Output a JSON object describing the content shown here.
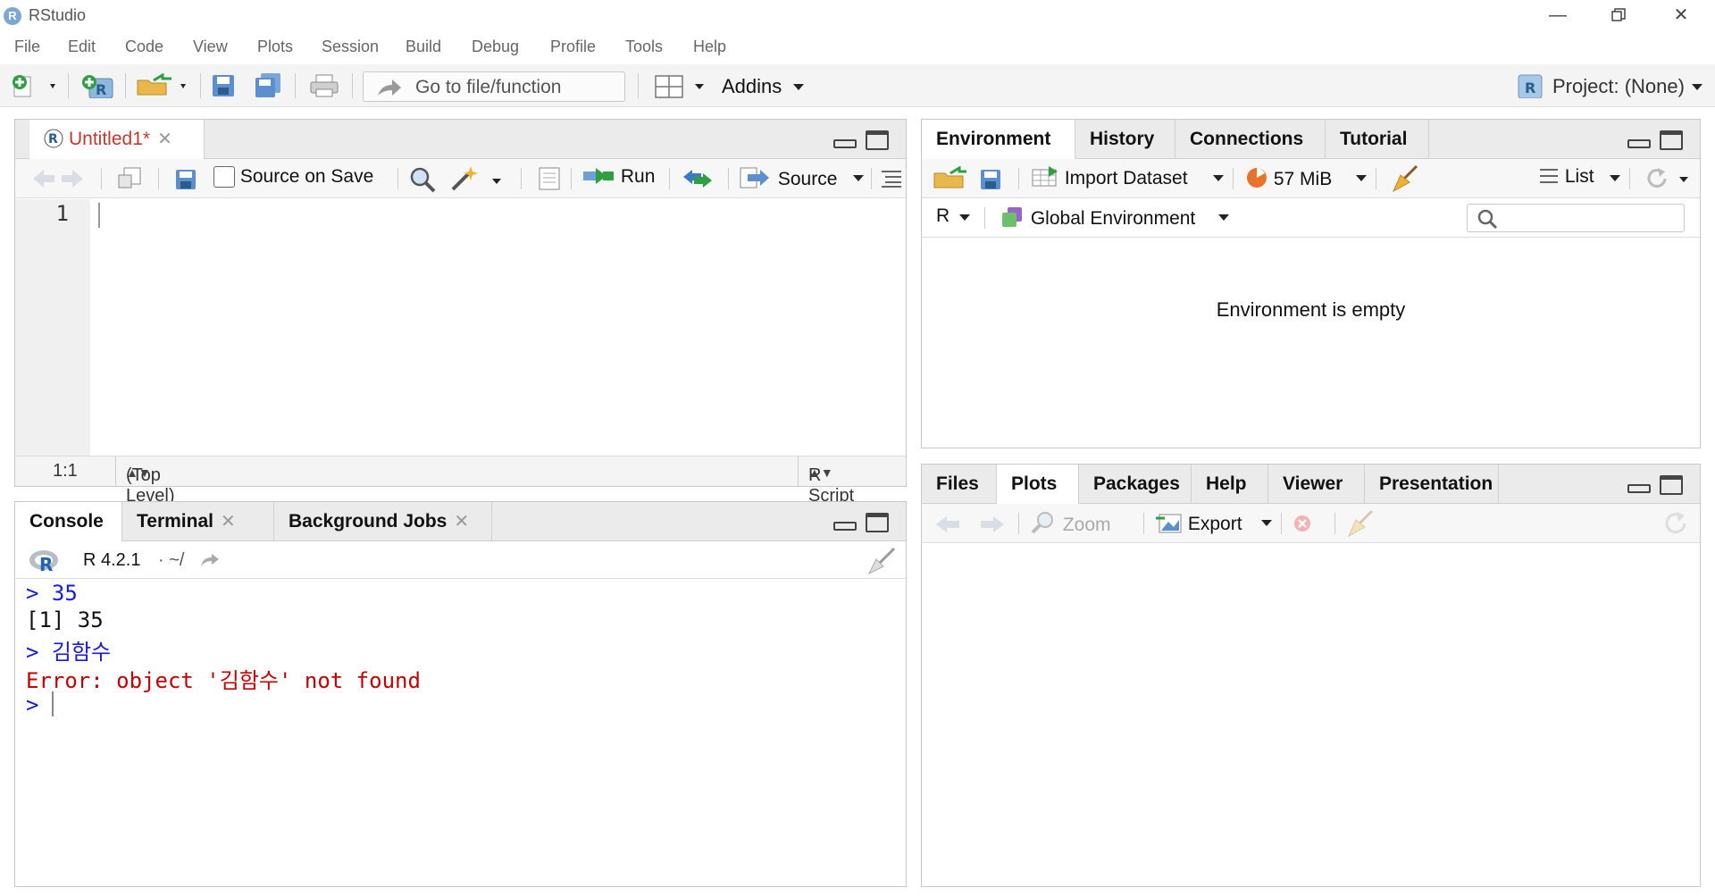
{
  "window": {
    "title": "RStudio",
    "logo": "R"
  },
  "menu": [
    "File",
    "Edit",
    "Code",
    "View",
    "Plots",
    "Session",
    "Build",
    "Debug",
    "Profile",
    "Tools",
    "Help"
  ],
  "toolbar": {
    "goto_placeholder": "Go to file/function",
    "addins": "Addins",
    "project": "Project: (None)"
  },
  "editor": {
    "tab": "Untitled1*",
    "source_on_save": "Source on Save",
    "run": "Run",
    "source": "Source",
    "line_number": "1",
    "position": "1:1",
    "scope": "(Top Level)",
    "file_type": "R Script"
  },
  "console": {
    "tabs": [
      "Console",
      "Terminal",
      "Background Jobs"
    ],
    "r_version": "R 4.2.1",
    "path": "·  ~/",
    "lines": [
      {
        "prompt": ">",
        "text": " 35",
        "kind": "input"
      },
      {
        "prompt": "",
        "text": "[1] 35",
        "kind": "output"
      },
      {
        "prompt": ">",
        "text": " 김함수",
        "kind": "input"
      },
      {
        "prompt": "",
        "text": "Error: object '김함수' not found",
        "kind": "error"
      },
      {
        "prompt": ">",
        "text": " ",
        "kind": "input"
      }
    ]
  },
  "environment": {
    "tabs": [
      "Environment",
      "History",
      "Connections",
      "Tutorial"
    ],
    "import_dataset": "Import Dataset",
    "memory": "57 MiB",
    "view_mode": "List",
    "language": "R",
    "scope": "Global Environment",
    "empty_message": "Environment is empty"
  },
  "files": {
    "tabs": [
      "Files",
      "Plots",
      "Packages",
      "Help",
      "Viewer",
      "Presentation"
    ],
    "zoom": "Zoom",
    "export": "Export"
  },
  "colors": {
    "accent_blue": "#1a1adb",
    "error_red": "#c40000",
    "tab_red": "#c0392b"
  }
}
